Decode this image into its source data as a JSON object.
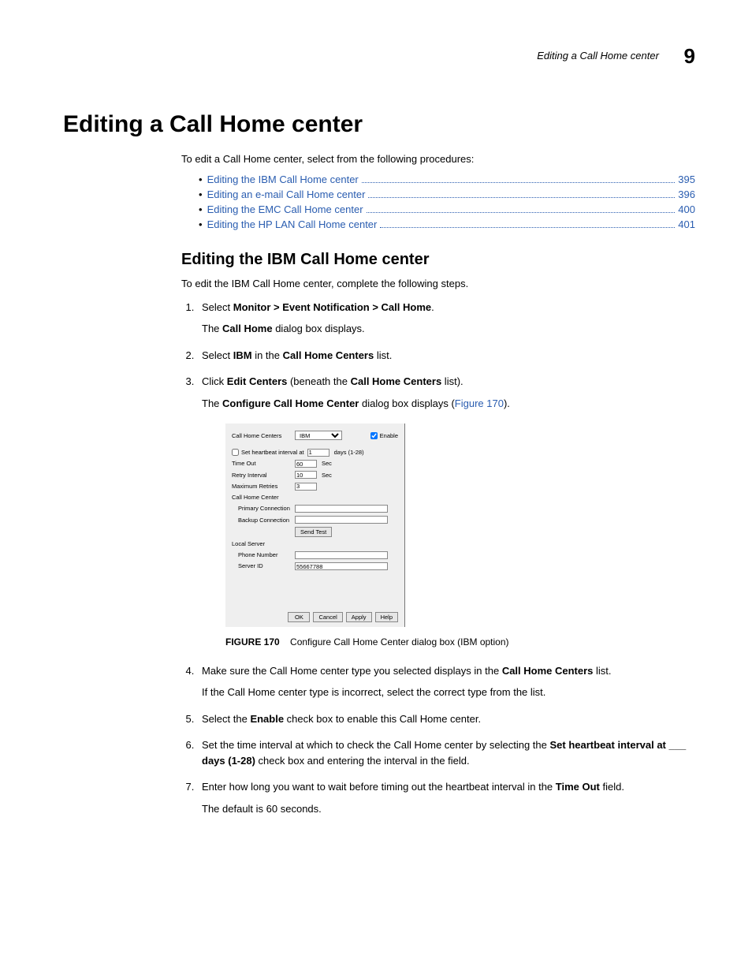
{
  "header": {
    "running_title": "Editing a Call Home center",
    "chapter_number": "9"
  },
  "title": "Editing a Call Home center",
  "intro": "To edit a Call Home center, select from the following procedures:",
  "toc": [
    {
      "label": "Editing the IBM Call Home center",
      "page": "395"
    },
    {
      "label": "Editing an e-mail Call Home center",
      "page": "396"
    },
    {
      "label": "Editing the EMC Call Home center",
      "page": "400"
    },
    {
      "label": "Editing the HP LAN Call Home center",
      "page": "401"
    }
  ],
  "subsection_title": "Editing the IBM Call Home center",
  "subsection_intro": "To edit the IBM Call Home center, complete the following steps.",
  "steps": {
    "s1_a": "Select ",
    "s1_b": "Monitor > Event Notification > Call Home",
    "s1_c": ".",
    "s1_sub_a": "The ",
    "s1_sub_b": "Call Home",
    "s1_sub_c": " dialog box displays.",
    "s2_a": "Select ",
    "s2_b": "IBM",
    "s2_c": " in the ",
    "s2_d": "Call Home Centers",
    "s2_e": " list.",
    "s3_a": "Click ",
    "s3_b": "Edit Centers",
    "s3_c": " (beneath the ",
    "s3_d": "Call Home Centers",
    "s3_e": " list).",
    "s3_sub_a": "The ",
    "s3_sub_b": "Configure Call Home Center",
    "s3_sub_c": " dialog box displays (",
    "s3_sub_d": "Figure 170",
    "s3_sub_e": ").",
    "s4_a": "Make sure the Call Home center type you selected displays in the ",
    "s4_b": "Call Home Centers",
    "s4_c": " list.",
    "s4_sub": "If the Call Home center type is incorrect, select the correct type from the list.",
    "s5_a": "Select the ",
    "s5_b": "Enable",
    "s5_c": " check box to enable this Call Home center.",
    "s6_a": "Set the time interval at which to check the Call Home center by selecting the ",
    "s6_b": "Set heartbeat interval at ___ days (1-28)",
    "s6_c": " check box and entering the interval in the field.",
    "s7_a": "Enter how long you want to wait before timing out the heartbeat interval in the ",
    "s7_b": "Time Out",
    "s7_c": " field.",
    "s7_sub": "The default is 60 seconds."
  },
  "figure": {
    "label": "FIGURE 170",
    "caption": "Configure Call Home Center dialog box (IBM option)"
  },
  "dialog": {
    "centers_label": "Call Home Centers",
    "centers_value": "IBM",
    "enable_label": "Enable",
    "heartbeat_label": "Set heartbeat interval at",
    "heartbeat_value": "1",
    "heartbeat_suffix": "days (1-28)",
    "timeout_label": "Time Out",
    "timeout_value": "60",
    "timeout_suffix": "Sec",
    "retry_label": "Retry Interval",
    "retry_value": "10",
    "retry_suffix": "Sec",
    "maxretries_label": "Maximum Retries",
    "maxretries_value": "3",
    "center_section": "Call Home Center",
    "primary_label": "Primary Connection",
    "primary_value": "",
    "backup_label": "Backup Connection",
    "backup_value": "",
    "sendtest": "Send Test",
    "local_section": "Local Server",
    "phone_label": "Phone Number",
    "phone_value": "",
    "serverid_label": "Server ID",
    "serverid_value": "55667788",
    "ok": "OK",
    "cancel": "Cancel",
    "apply": "Apply",
    "help": "Help"
  }
}
